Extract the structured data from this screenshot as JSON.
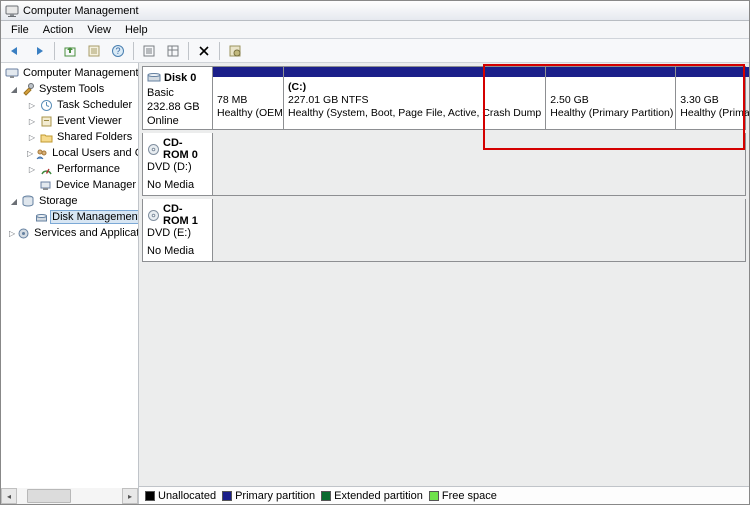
{
  "window": {
    "title": "Computer Management"
  },
  "menu": {
    "file": "File",
    "action": "Action",
    "view": "View",
    "help": "Help"
  },
  "tree": {
    "root": "Computer Management (Local",
    "systools": "System Tools",
    "task": "Task Scheduler",
    "event": "Event Viewer",
    "shared": "Shared Folders",
    "users": "Local Users and Groups",
    "perf": "Performance",
    "devmgr": "Device Manager",
    "storage": "Storage",
    "diskmgmt": "Disk Management",
    "services": "Services and Applications"
  },
  "disks": [
    {
      "name": "Disk 0",
      "type": "Basic",
      "size": "232.88 GB",
      "status": "Online",
      "parts": [
        {
          "size": "78 MB",
          "status": "Healthy (OEM Pa",
          "letter": ""
        },
        {
          "letter": "(C:)",
          "size": "227.01 GB NTFS",
          "status": "Healthy (System, Boot, Page File, Active, Crash Dump"
        },
        {
          "letter": "",
          "size": "2.50 GB",
          "status": "Healthy (Primary Partition)"
        },
        {
          "letter": "",
          "size": "3.30 GB",
          "status": "Healthy (Primary Partition)"
        }
      ]
    }
  ],
  "cdroms": [
    {
      "name": "CD-ROM 0",
      "type": "DVD (D:)",
      "status": "No Media"
    },
    {
      "name": "CD-ROM 1",
      "type": "DVD (E:)",
      "status": "No Media"
    }
  ],
  "legend": {
    "unalloc": "Unallocated",
    "primary": "Primary partition",
    "extended": "Extended partition",
    "free": "Free space"
  }
}
